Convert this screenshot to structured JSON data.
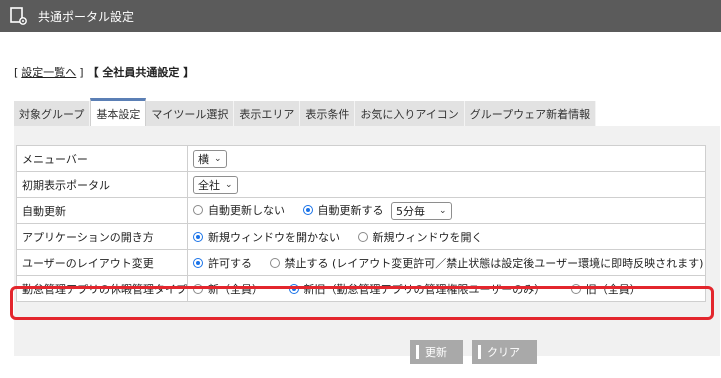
{
  "app": {
    "title": "共通ポータル設定",
    "icon": "portal-settings-icon"
  },
  "breadcrumb": {
    "open": "[",
    "link_label": "設定一覧へ",
    "close": "]",
    "current": "【 全社員共通設定 】"
  },
  "tabs": [
    {
      "label": "対象グループ",
      "active": false
    },
    {
      "label": "基本設定",
      "active": true
    },
    {
      "label": "マイツール選択",
      "active": false
    },
    {
      "label": "表示エリア",
      "active": false
    },
    {
      "label": "表示条件",
      "active": false
    },
    {
      "label": "お気に入りアイコン",
      "active": false
    },
    {
      "label": "グループウェア新着情報",
      "active": false
    }
  ],
  "settings": {
    "menubar": {
      "label": "メニューバー",
      "value": "横"
    },
    "initial_portal": {
      "label": "初期表示ポータル",
      "value": "全社"
    },
    "auto_update": {
      "label": "自動更新",
      "opt_off": "自動更新しない",
      "opt_on": "自動更新する",
      "selected": "on",
      "interval": "5分毎"
    },
    "app_open": {
      "label": "アプリケーションの開き方",
      "opt_same": "新規ウィンドウを開かない",
      "opt_new": "新規ウィンドウを開く",
      "selected": "same"
    },
    "layout_change": {
      "label": "ユーザーのレイアウト変更",
      "opt_allow": "許可する",
      "opt_deny": "禁止する (レイアウト変更許可／禁止状態は設定後ユーザー環境に即時反映されます)",
      "selected": "allow"
    },
    "leave_type": {
      "label": "勤怠管理アプリの休暇管理タイプ",
      "opt_new_all": "新（全員）",
      "opt_mixed": "新旧（勤怠管理アプリの管理権限ユーザーのみ）",
      "opt_old_all": "旧（全員）",
      "selected": "mixed"
    }
  },
  "buttons": {
    "update": "更新",
    "clear": "クリア"
  },
  "colors": {
    "titlebar": "#5b5b5b",
    "highlight": "#e3262d",
    "radio_on": "#1a73e8"
  }
}
